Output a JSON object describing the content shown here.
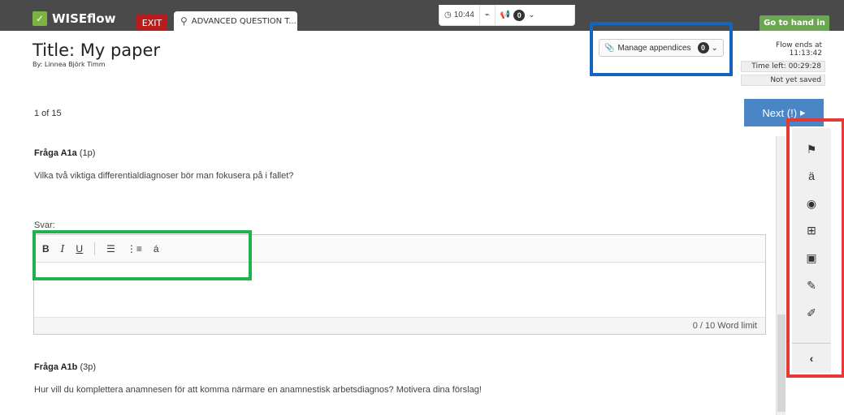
{
  "header": {
    "app_name": "WISEflow",
    "exit_label": "EXIT",
    "tab_label": "ADVANCED QUESTION T...",
    "time": "10:44",
    "notif_count": "0",
    "go_hand_in": "Go to hand in"
  },
  "paper": {
    "title": "Title: My paper",
    "author": "By: Linnea Björk Timm"
  },
  "appendices": {
    "label": "Manage appendices",
    "count": "0"
  },
  "flow": {
    "ends": "Flow ends at 11:13:42",
    "time_left": "Time left: 00:29:28",
    "save_status": "Not yet saved"
  },
  "nav": {
    "progress": "1 of 15",
    "next_label": "Next (!)"
  },
  "questions": [
    {
      "label": "Fråga A1a",
      "points": "(1p)",
      "text": "Vilka två viktiga differentialdiagnoser bör man fokusera på i fallet?"
    },
    {
      "label": "Fråga A1b",
      "points": "(3p)",
      "text": "Hur vill du komplettera anamnesen för att komma närmare en anamnestisk arbetsdiagnos? Motivera dina förslag!"
    }
  ],
  "answer": {
    "label": "Svar:",
    "toolbar": {
      "bold": "B",
      "italic": "I",
      "underline": "U",
      "special_char": "á"
    },
    "word_count": "0 / 10 Word limit"
  },
  "sidebar": {
    "icons": [
      "flag-icon",
      "translate-icon",
      "accessibility-icon",
      "add-note-icon",
      "note-icon",
      "pen-icon",
      "highlighter-icon"
    ],
    "collapse": "‹"
  },
  "colors": {
    "topbar": "#4a4a4a",
    "exit": "#b71c1c",
    "go_hand_in": "#6aa84f",
    "next": "#4a86c5",
    "annotation_blue": "#1565c0",
    "annotation_green": "#22b14c",
    "annotation_red": "#e53935"
  }
}
